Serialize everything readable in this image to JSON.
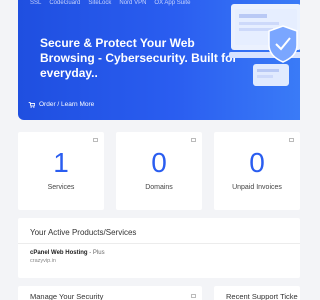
{
  "hero": {
    "tabs": [
      "SSL",
      "CodeGuard",
      "SiteLock",
      "Nord VPN",
      "OX App Suite"
    ],
    "title": "Secure & Protect Your Web Browsing - Cybersecurity. Built for everyday..",
    "link": "Order / Learn More"
  },
  "stats": [
    {
      "value": "1",
      "label": "Services"
    },
    {
      "value": "0",
      "label": "Domains"
    },
    {
      "value": "0",
      "label": "Unpaid Invoices"
    }
  ],
  "products": {
    "title": "Your Active Products/Services",
    "name": "cPanel Web Hosting",
    "separator": " - ",
    "plan": "Plus",
    "domain": "crazyvip.in"
  },
  "bottom": {
    "security_title": "Manage Your Security",
    "tickets_title": "Recent Support Ticke"
  },
  "colors": {
    "accent": "#2a5df0",
    "hero_start": "#1f4fe0",
    "hero_end": "#3a7bf7"
  }
}
